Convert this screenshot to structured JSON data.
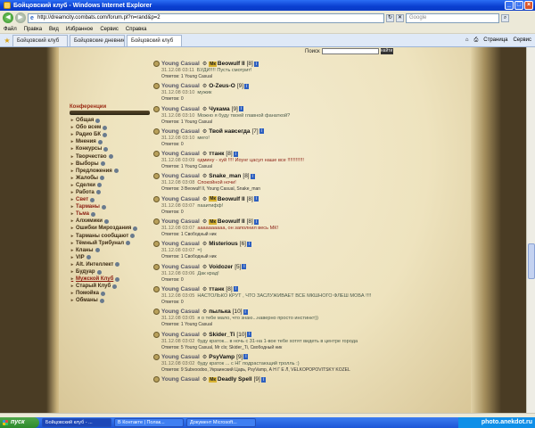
{
  "window": {
    "title": "Бойцовский клуб - Windows Internet Explorer"
  },
  "addressbar": {
    "url": "http://dreamcity.combats.com/forum.pl?n=rand&p=2",
    "search_placeholder": "Google"
  },
  "menu": [
    "Файл",
    "Правка",
    "Вид",
    "Избранное",
    "Сервис",
    "Справка"
  ],
  "tabs": [
    {
      "label": "Бойцовский клуб"
    },
    {
      "label": "Бойцовские дневники - You..."
    },
    {
      "label": "Бойцовский клуб"
    }
  ],
  "tab_tools": {
    "page": "Страница",
    "tools": "Сервис"
  },
  "forum_search": {
    "label": "Поиск",
    "button": "найти"
  },
  "sidebar": {
    "title": "Конференции",
    "items": [
      {
        "label": "Общая",
        "style": "normal"
      },
      {
        "label": "Обо всем",
        "style": "normal"
      },
      {
        "label": "Радио БК",
        "style": "normal"
      },
      {
        "label": "Мнения",
        "style": "normal"
      },
      {
        "label": "Конкурсы",
        "style": "normal"
      },
      {
        "label": "Творчество",
        "style": "normal"
      },
      {
        "label": "Выборы",
        "style": "normal"
      },
      {
        "label": "Предложения",
        "style": "normal"
      },
      {
        "label": "Жалобы",
        "style": "normal"
      },
      {
        "label": "Сделки",
        "style": "normal"
      },
      {
        "label": "Работа",
        "style": "normal"
      },
      {
        "label": "Свет",
        "style": "red"
      },
      {
        "label": "Тарманы",
        "style": "red"
      },
      {
        "label": "Тьма",
        "style": "red"
      },
      {
        "label": "Алхимики",
        "style": "normal"
      },
      {
        "label": "Ошибки Мироздания",
        "style": "normal"
      },
      {
        "label": "Тарманы сообщают",
        "style": "normal"
      },
      {
        "label": "Тёмный Трибунал",
        "style": "normal"
      },
      {
        "label": "Кланы",
        "style": "normal"
      },
      {
        "label": "VIP",
        "style": "normal"
      },
      {
        "label": "Alt. Интеллект",
        "style": "normal"
      },
      {
        "label": "Будуар",
        "style": "normal"
      },
      {
        "label": "Мужской Клуб",
        "style": "red-under"
      },
      {
        "label": "Старый Клуб",
        "style": "normal"
      },
      {
        "label": "Помойка",
        "style": "normal"
      },
      {
        "label": "Обманы",
        "style": "normal"
      }
    ]
  },
  "posts": [
    {
      "author": "Young Casual",
      "badge": "Мк",
      "target": "Beowulf II",
      "level": "[8]",
      "time": "31.12.08 03:11",
      "text": "БУДИ!!!! Пусть смотрит!",
      "replies": "Ответов: 1   Young Casual",
      "red": false
    },
    {
      "author": "Young Casual",
      "badge": "",
      "target": "O-Zeus-O",
      "level": "[9]",
      "time": "31.12.08 03:10",
      "text": "мужик",
      "replies": "Ответов: 0",
      "red": false
    },
    {
      "author": "Young Casual",
      "badge": "",
      "target": "Чукама",
      "level": "[9]",
      "time": "31.12.08 03:10",
      "text": "Можно я буду твоей главной фанаткой?",
      "replies": "Ответов: 1   Young Casual",
      "red": false
    },
    {
      "author": "Young Casual",
      "badge": "",
      "target": "Твой навсегда",
      "level": "[7]",
      "time": "31.12.08 03:10",
      "text": "мего!",
      "replies": "Ответов: 0",
      "red": false
    },
    {
      "author": "Young Casual",
      "badge": "",
      "target": "ттанк",
      "level": "[8]",
      "time": "31.12.08 03:09",
      "text": "одмину - хуй !!!! Йоунг цасул наше все !!!!!!!!!!!!",
      "replies": "Ответов: 1   Young Casual",
      "red": true
    },
    {
      "author": "Young Casual",
      "badge": "",
      "target": "Snake_man",
      "level": "[8]",
      "time": "31.12.08 03:08",
      "text": "Спокойной ночи!",
      "replies": "Ответов: 3   Beowulf II, Young Casual, Snake_man",
      "red": true
    },
    {
      "author": "Young Casual",
      "badge": "Мк",
      "target": "Beowulf II",
      "level": "[8]",
      "time": "31.12.08 03:07",
      "text": "пааитифф!",
      "replies": "Ответов: 0",
      "red": false
    },
    {
      "author": "Young Casual",
      "badge": "Мк",
      "target": "Beowulf II",
      "level": "[8]",
      "time": "31.12.08 03:07",
      "text": "аааааааааа, он заполнил весь МК!",
      "replies": "Ответов: 1   Свободный ник",
      "red": true
    },
    {
      "author": "Young Casual",
      "badge": "",
      "target": "Misterious",
      "level": "[6]",
      "time": "31.12.08 03:07",
      "text": "=)",
      "replies": "Ответов: 1   Свободный ник",
      "red": false
    },
    {
      "author": "Young Casual",
      "badge": "",
      "target": "Voidozer",
      "level": "[5]",
      "time": "31.12.08 03:06",
      "text": "Дак крад!",
      "replies": "Ответов: 0",
      "red": false
    },
    {
      "author": "Young Casual",
      "badge": "",
      "target": "ттанк",
      "level": "[8]",
      "time": "31.12.08 03:05",
      "text": "НАСТОЛЬКО КРУТ , ЧТО ЗАСЛУЖИВАЕТ ВСЕ МКШНОГО ФЛЕШ МОБА !!!!",
      "replies": "Ответов: 0",
      "red": false
    },
    {
      "author": "Young Casual",
      "badge": "",
      "target": "пылька",
      "level": "[10]",
      "time": "31.12.08 03:05",
      "text": "я о тебе мало, что знаю...наверно просто инстинкт))",
      "replies": "Ответов: 1   Young Casual",
      "red": false
    },
    {
      "author": "Young Casual",
      "badge": "",
      "target": "Skider_Ti",
      "level": "[10]",
      "time": "31.12.08 03:02",
      "text": "буду краток... в ночь с 31-на 1-вое тебе хотят видеть в центре города",
      "replies": "Ответов: 5   Young Casual, Mr cls; Skider_Ti, Свободный ник",
      "red": false
    },
    {
      "author": "Young Casual",
      "badge": "",
      "target": "PsyVamp",
      "level": "[9]",
      "time": "31.12.08 03:02",
      "text": "буду краток ... с НГ подрастающий тролль :)",
      "replies": "Ответов: 9   Subvoodoo, Украинский Царь, PsyVamp, А Н Г Е Л, VELKOPOPOVITSKY KOZEL",
      "red": false
    },
    {
      "author": "Young Casual",
      "badge": "Мк",
      "target": "Deadly Spell",
      "level": "[9]",
      "time": "",
      "text": "",
      "replies": "",
      "red": false
    }
  ],
  "taskbar": {
    "start": "пуск",
    "items": [
      {
        "label": "Бойцовский клуб - ..."
      },
      {
        "label": "В Контакте | Полак..."
      },
      {
        "label": "Документ Microsoft..."
      }
    ],
    "tray": "photo.anekdot.ru"
  },
  "colors": {
    "page_bg": "#eee3be",
    "frame": "#4a3c24",
    "titlebar": "#0a3fd1",
    "red_text": "#8b1f14"
  }
}
